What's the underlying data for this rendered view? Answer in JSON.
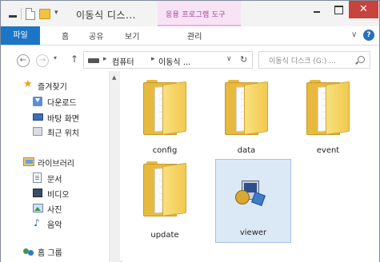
{
  "titlebar": {
    "title": "이동식 디스...",
    "context_tab_header": "응용 프로그램 도구",
    "close_glyph": "✕"
  },
  "ribbon": {
    "tabs": [
      {
        "label": "파일"
      },
      {
        "label": "홈"
      },
      {
        "label": "공유"
      },
      {
        "label": "보기"
      },
      {
        "label": "관리"
      }
    ],
    "expand_glyph": "∨",
    "help_glyph": "?"
  },
  "address": {
    "back_glyph": "←",
    "forward_glyph": "→",
    "recent_glyph": "▾",
    "up_glyph": "↑",
    "crumb_sep": "▸",
    "crumbs": [
      "컴퓨터",
      "이동식 ..."
    ],
    "dropdown_glyph": "∨",
    "refresh_glyph": "↻",
    "search_placeholder": "이동식 디스크 (G:) ..."
  },
  "navpane": {
    "scroll_up_glyph": "▲",
    "favorites": {
      "label": "즐겨찾기",
      "icon": "star-icon"
    },
    "favorite_items": [
      {
        "label": "다운로드",
        "icon": "download-icon"
      },
      {
        "label": "바탕 화면",
        "icon": "desktop-icon"
      },
      {
        "label": "최근 위치",
        "icon": "recent-places-icon"
      }
    ],
    "libraries": {
      "label": "라이브러리",
      "icon": "library-icon"
    },
    "library_items": [
      {
        "label": "문서",
        "icon": "documents-icon"
      },
      {
        "label": "비디오",
        "icon": "videos-icon"
      },
      {
        "label": "사진",
        "icon": "pictures-icon"
      },
      {
        "label": "음악",
        "icon": "music-icon"
      }
    ],
    "homegroup": {
      "label": "홈 그룹",
      "icon": "homegroup-icon"
    }
  },
  "content": {
    "items": [
      {
        "name": "config",
        "type": "folder",
        "icon": "folder-icon",
        "selected": false
      },
      {
        "name": "data",
        "type": "folder",
        "icon": "folder-icon",
        "selected": false
      },
      {
        "name": "event",
        "type": "folder",
        "icon": "folder-icon",
        "selected": false
      },
      {
        "name": "update",
        "type": "folder",
        "icon": "folder-icon",
        "selected": false
      },
      {
        "name": "viewer",
        "type": "application",
        "icon": "installer-icon",
        "selected": true
      }
    ]
  },
  "colors": {
    "file_tab": "#1d75c6",
    "close_button": "#c7433d",
    "context_tab": "#a8459b",
    "selection": "#dbe9f7",
    "folder": "#e7b93e"
  }
}
